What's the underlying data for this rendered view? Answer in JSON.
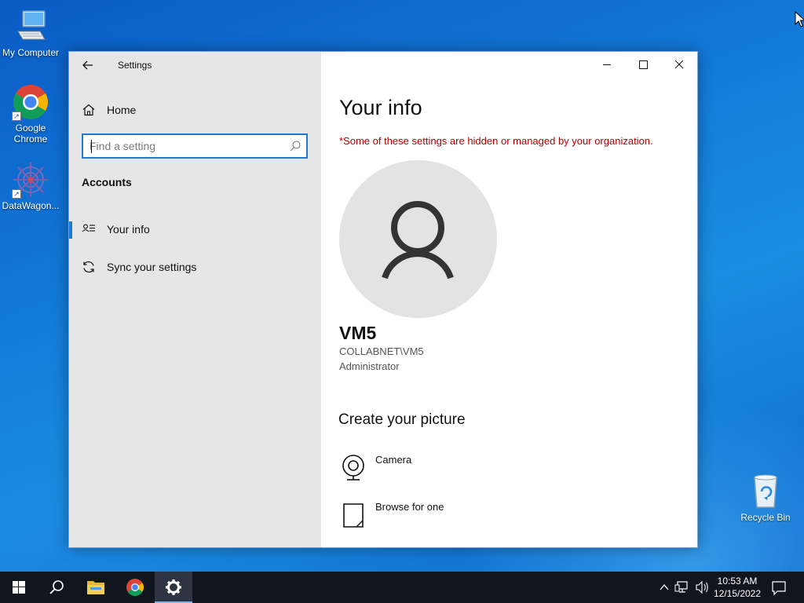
{
  "desktop": {
    "icons": [
      {
        "label": "My Computer",
        "icon": "computer-icon"
      },
      {
        "label": "Google Chrome",
        "icon": "chrome-icon"
      },
      {
        "label": "DataWagon...",
        "icon": "datawagon-icon"
      },
      {
        "label": "Recycle Bin",
        "icon": "recycle-bin-icon"
      }
    ]
  },
  "window": {
    "app_title": "Settings",
    "sidebar": {
      "home_label": "Home",
      "search_placeholder": "Find a setting",
      "section": "Accounts",
      "items": [
        {
          "label": "Your info",
          "icon": "person-list-icon",
          "selected": true
        },
        {
          "label": "Sync your settings",
          "icon": "sync-icon",
          "selected": false
        }
      ]
    },
    "content": {
      "title": "Your info",
      "warning": "*Some of these settings are hidden or managed by your organization.",
      "user": {
        "name": "VM5",
        "domain_account": "COLLABNET\\VM5",
        "role": "Administrator"
      },
      "create_picture_title": "Create your picture",
      "options": [
        {
          "label": "Camera",
          "icon": "camera-icon"
        },
        {
          "label": "Browse for one",
          "icon": "file-icon"
        }
      ]
    }
  },
  "taskbar": {
    "apps": [
      "start-icon",
      "search-icon",
      "file-explorer-icon",
      "chrome-icon",
      "settings-icon"
    ],
    "active_app": "settings-icon",
    "time": "10:53 AM",
    "date": "12/15/2022"
  },
  "colors": {
    "accent": "#1f7ad1",
    "warning": "#b40000",
    "sidebar_bg": "#e6e6e6",
    "taskbar_bg": "#10151e"
  }
}
